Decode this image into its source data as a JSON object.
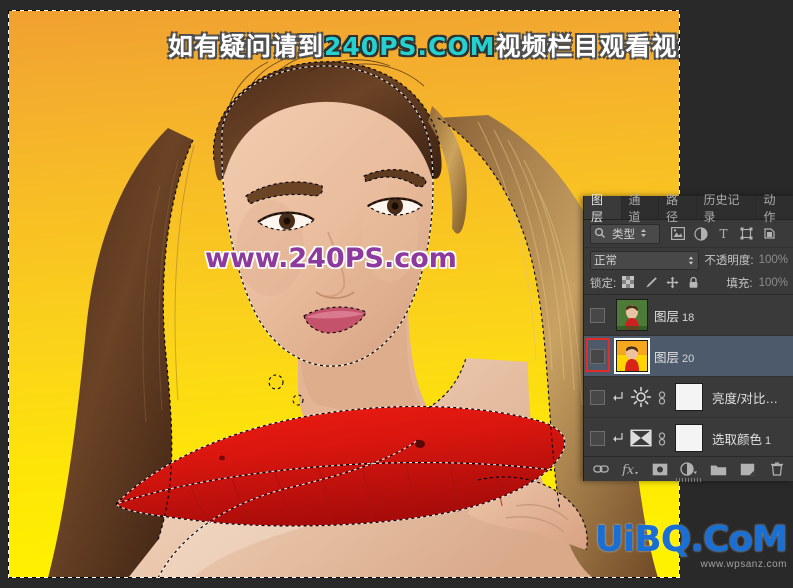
{
  "app": {
    "name": "Adobe Photoshop",
    "workspace_bg": "#292929"
  },
  "canvas": {
    "gradient_top": "#f0a030",
    "gradient_bottom": "#fff300",
    "selection_style": "marching-ants",
    "subject": "woman portrait holding red leaf"
  },
  "watermarks": {
    "top": {
      "prefix": "如有疑问请到",
      "brand": "240PS.COM",
      "suffix": "视频栏目观看视频教程",
      "brand_color": "#25d0cf",
      "text_color": "#ffffff"
    },
    "center": {
      "text": "www.240PS.com",
      "color": "#8d3a9e",
      "stroke_color": "#ffffff"
    },
    "logo": {
      "text": "UiBQ.CoM",
      "subtext": "www.wpsanz.com",
      "color": "#1a6fd4"
    }
  },
  "panel": {
    "tabs": [
      {
        "label": "图层",
        "active": true
      },
      {
        "label": "通道",
        "active": false
      },
      {
        "label": "路径",
        "active": false
      },
      {
        "label": "历史记录",
        "active": false
      },
      {
        "label": "动作",
        "active": false
      }
    ],
    "filter": {
      "type_label": "类型",
      "icons": [
        "pixel-filter-icon",
        "adjustment-filter-icon",
        "type-filter-icon",
        "shape-filter-icon",
        "smartobject-filter-icon"
      ]
    },
    "blend": {
      "mode": "正常",
      "opacity_label": "不透明度:",
      "opacity_value": "100%"
    },
    "lock": {
      "label": "锁定:",
      "icons": [
        "lock-transparent-icon",
        "lock-image-icon",
        "lock-position-icon",
        "lock-all-icon"
      ],
      "fill_label": "填充:",
      "fill_value": "100%"
    },
    "layers": [
      {
        "name": "图层",
        "number": "18",
        "visible": false,
        "selected": false,
        "kind": "pixel",
        "thumb_bg": "#3f6a2f",
        "highlighted_eye": false
      },
      {
        "name": "图层",
        "number": "20",
        "visible": false,
        "selected": true,
        "kind": "pixel",
        "thumb_bg": "#f5a81e",
        "highlighted_eye": true
      },
      {
        "name": "亮度/对比…",
        "number": "",
        "visible": false,
        "selected": false,
        "kind": "adjustment-brightness",
        "clipped": true,
        "mask": true
      },
      {
        "name": "选取颜色",
        "number": "1",
        "visible": false,
        "selected": false,
        "kind": "adjustment-selective-color",
        "clipped": true,
        "mask": true
      }
    ],
    "bottom_buttons": [
      "link-layers-icon",
      "layer-style-fx-icon",
      "add-mask-icon",
      "new-adjustment-icon",
      "new-group-icon",
      "new-layer-icon",
      "delete-layer-icon"
    ],
    "highlight_color": "#e22b2b"
  }
}
